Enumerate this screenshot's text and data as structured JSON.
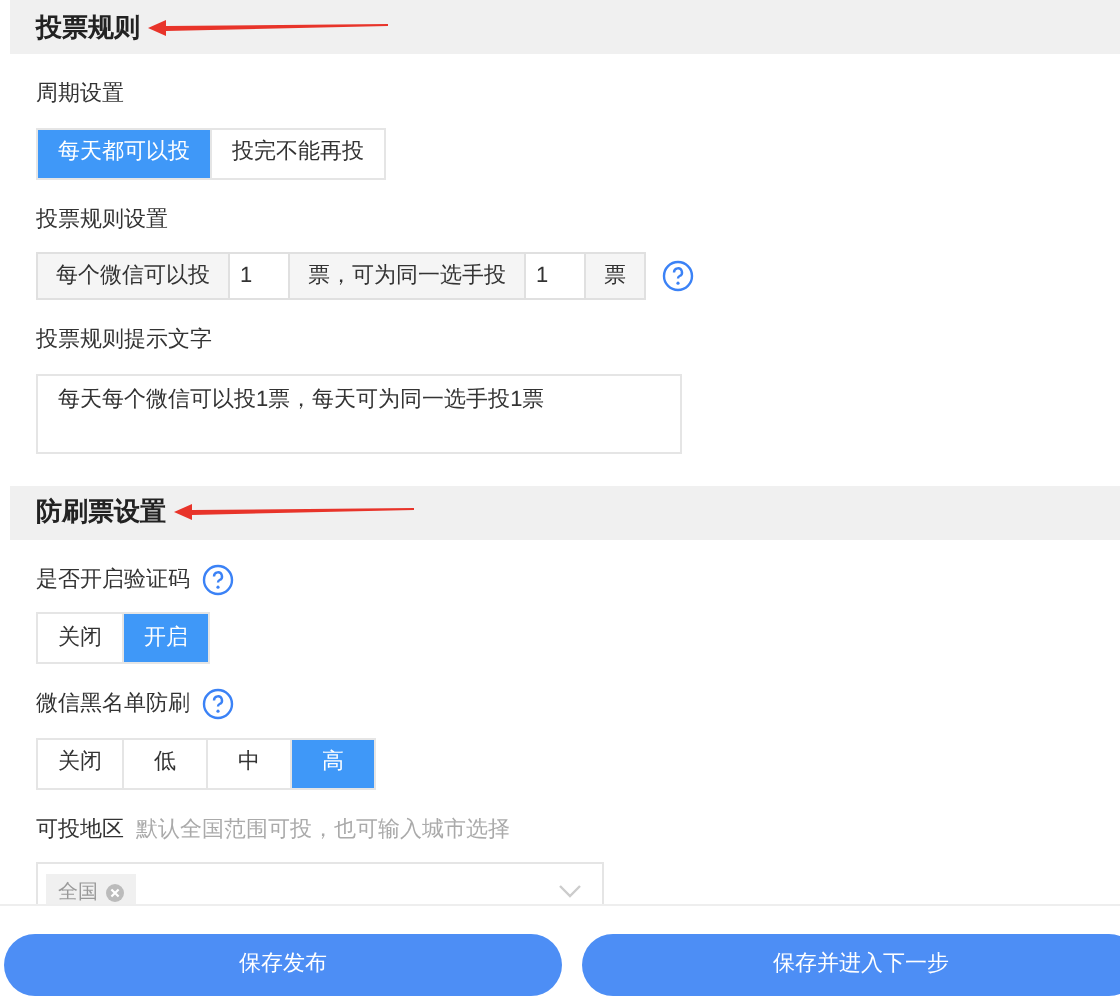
{
  "sections": [
    {
      "title": "投票规则",
      "fields": [
        {
          "kind": "segmented",
          "label": "周期设置",
          "help": false,
          "options": [
            {
              "label": "每天都可以投",
              "selected": true
            },
            {
              "label": "投完不能再投",
              "selected": false
            }
          ]
        },
        {
          "kind": "rule",
          "label": "投票规则设置",
          "help": true,
          "parts": [
            {
              "kind": "text",
              "text": "每个微信可以投"
            },
            {
              "kind": "input",
              "value": "1"
            },
            {
              "kind": "text",
              "text": "票，可为同一选手投"
            },
            {
              "kind": "input",
              "value": "1"
            },
            {
              "kind": "text",
              "text": "票"
            }
          ]
        },
        {
          "kind": "textarea",
          "label": "投票规则提示文字",
          "help": false,
          "value": "每天每个微信可以投1票，每天可为同一选手投1票"
        }
      ]
    },
    {
      "title": "防刷票设置",
      "fields": [
        {
          "kind": "segmented",
          "label": "是否开启验证码",
          "help": true,
          "options": [
            {
              "label": "关闭",
              "selected": false
            },
            {
              "label": "开启",
              "selected": true
            }
          ]
        },
        {
          "kind": "segmented",
          "label": "微信黑名单防刷",
          "help": true,
          "options": [
            {
              "label": "关闭",
              "selected": false
            },
            {
              "label": "低",
              "selected": false
            },
            {
              "label": "中",
              "selected": false
            },
            {
              "label": "高",
              "selected": true
            }
          ]
        },
        {
          "kind": "region",
          "label": "可投地区",
          "help": false,
          "hint": "默认全国范围可投，也可输入城市选择",
          "tags": [
            "全国"
          ]
        }
      ]
    }
  ],
  "buttons": [
    "保存发布",
    "保存并进入下一步"
  ]
}
